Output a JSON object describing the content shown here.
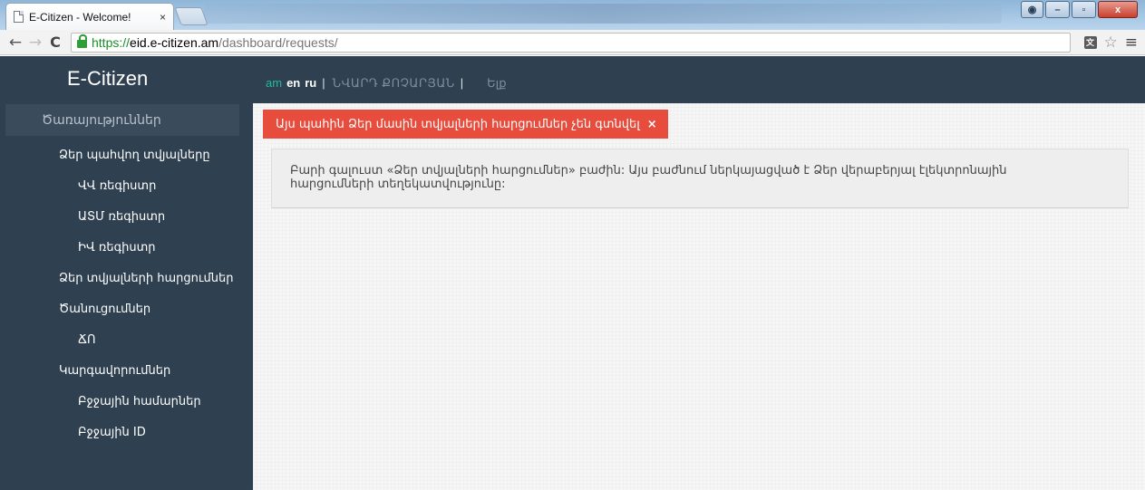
{
  "browser": {
    "tab_title": "E-Citizen - Welcome!",
    "tab_close": "×",
    "url_scheme": "https://",
    "url_host": "eid.e-citizen.am",
    "url_path": "/dashboard/requests/",
    "icons": [
      "back-arrow-icon",
      "forward-arrow-icon",
      "reload-icon",
      "lock-icon",
      "translate-icon",
      "star-icon",
      "menu-icon"
    ],
    "window_buttons": {
      "minimize": "–",
      "maximize": "▫",
      "close": "x"
    }
  },
  "header": {
    "brand": "E-Citizen",
    "lang_am": "am",
    "lang_en": "en",
    "lang_ru": "ru",
    "separator": "|",
    "user_name": "ՆՎԱՐԴ ՔՈՉԱՐՅԱՆ",
    "logout": "Ելք"
  },
  "sidebar": {
    "heading": "Ծառայություններ",
    "items": [
      {
        "label": "Ձեր պահվող տվյալները",
        "level": 1
      },
      {
        "label": "ՎՎ ռեգիստր",
        "level": 2
      },
      {
        "label": "ԱՏՄ ռեգիստր",
        "level": 2
      },
      {
        "label": "ԻՎ ռեգիստր",
        "level": 2
      },
      {
        "label": "Ձեր տվյալների հարցումներ",
        "level": 1
      },
      {
        "label": "Ծանուցումներ",
        "level": 1
      },
      {
        "label": "ՃՈ",
        "level": 2
      },
      {
        "label": "Կարգավորումներ",
        "level": 1
      },
      {
        "label": "Բջջային համարներ",
        "level": 2
      },
      {
        "label": "Բջջային ID",
        "level": 2
      }
    ]
  },
  "main": {
    "alert_text": "Այս պահին Ձեր մասին տվյալների հարցումներ չեն գտնվել",
    "alert_close": "×",
    "info_text": "Բարի գալուստ «Ձեր տվյալների հարցումներ» բաժին: Այս բաժնում ներկայացված է Ձեր վերաբերյալ էլեկտրոնային հարցումների տեղեկատվությունը:"
  },
  "colors": {
    "sidebar_bg": "#2f4050",
    "alert_bg": "#e74c3c",
    "accent": "#25b89e"
  }
}
